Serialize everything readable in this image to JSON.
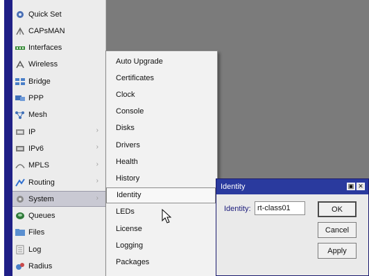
{
  "sidebar": {
    "items": [
      {
        "label": "Quick Set",
        "icon": "quick-set-icon",
        "has_submenu": false
      },
      {
        "label": "CAPsMAN",
        "icon": "capsman-icon",
        "has_submenu": false
      },
      {
        "label": "Interfaces",
        "icon": "interfaces-icon",
        "has_submenu": false
      },
      {
        "label": "Wireless",
        "icon": "wireless-icon",
        "has_submenu": false
      },
      {
        "label": "Bridge",
        "icon": "bridge-icon",
        "has_submenu": false
      },
      {
        "label": "PPP",
        "icon": "ppp-icon",
        "has_submenu": false
      },
      {
        "label": "Mesh",
        "icon": "mesh-icon",
        "has_submenu": false
      },
      {
        "label": "IP",
        "icon": "ip-icon",
        "has_submenu": true
      },
      {
        "label": "IPv6",
        "icon": "ipv6-icon",
        "has_submenu": true
      },
      {
        "label": "MPLS",
        "icon": "mpls-icon",
        "has_submenu": true
      },
      {
        "label": "Routing",
        "icon": "routing-icon",
        "has_submenu": true
      },
      {
        "label": "System",
        "icon": "system-icon",
        "has_submenu": true,
        "selected": true
      },
      {
        "label": "Queues",
        "icon": "queues-icon",
        "has_submenu": false
      },
      {
        "label": "Files",
        "icon": "files-icon",
        "has_submenu": false
      },
      {
        "label": "Log",
        "icon": "log-icon",
        "has_submenu": false
      },
      {
        "label": "Radius",
        "icon": "radius-icon",
        "has_submenu": false
      }
    ]
  },
  "submenu": {
    "items": [
      {
        "label": "Auto Upgrade"
      },
      {
        "label": "Certificates"
      },
      {
        "label": "Clock"
      },
      {
        "label": "Console"
      },
      {
        "label": "Disks"
      },
      {
        "label": "Drivers"
      },
      {
        "label": "Health"
      },
      {
        "label": "History"
      },
      {
        "label": "Identity",
        "selected": true
      },
      {
        "label": "LEDs"
      },
      {
        "label": "License"
      },
      {
        "label": "Logging"
      },
      {
        "label": "Packages"
      }
    ]
  },
  "dialog": {
    "title": "Identity",
    "field_label": "Identity:",
    "field_value": "rt-class01",
    "ok_label": "OK",
    "cancel_label": "Cancel",
    "apply_label": "Apply",
    "restore_glyph": "▣",
    "close_glyph": "✕"
  },
  "colors": {
    "title_bar": "#2a3a9e",
    "desktop": "#7b7b7b",
    "sidebar_strip": "#1f1f86",
    "selection": "#c9c9d3"
  }
}
